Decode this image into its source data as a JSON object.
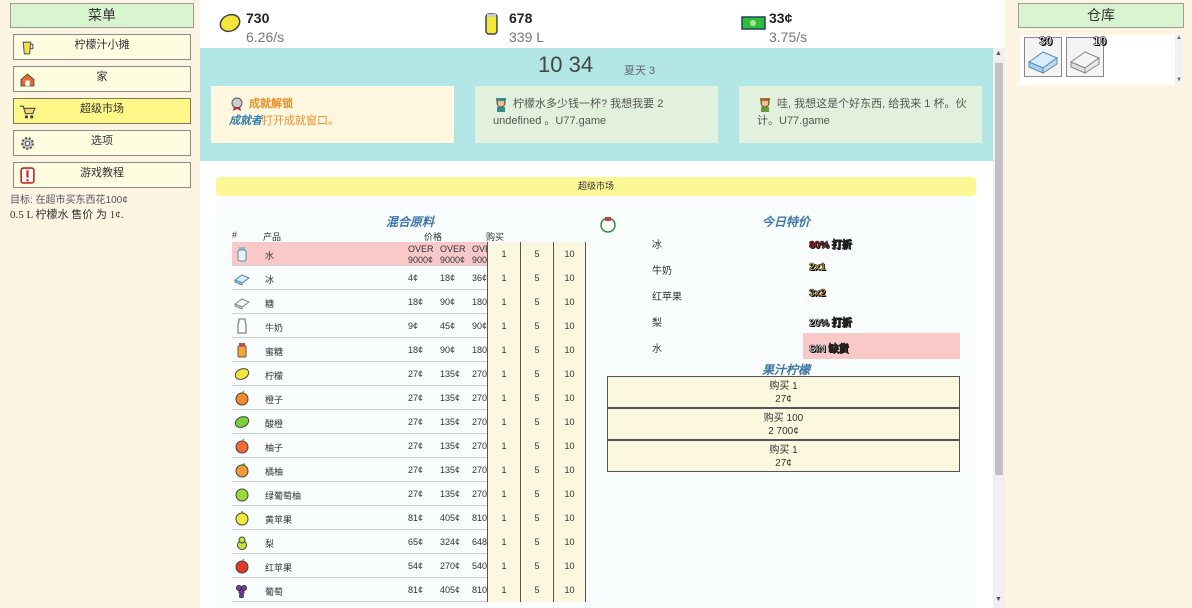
{
  "menu": {
    "title": "菜单",
    "items": [
      {
        "label": "柠檬汁小摊",
        "icon": "lemonade-pitcher-icon"
      },
      {
        "label": "家",
        "icon": "house-icon"
      },
      {
        "label": "超级市场",
        "icon": "shopping-cart-icon"
      },
      {
        "label": "选项",
        "icon": "gear-icon"
      },
      {
        "label": "游戏教程",
        "icon": "exclamation-icon"
      }
    ],
    "goal_label": "目标:",
    "goal_text": "在超市买东西花100¢",
    "goal_line2": "0.5 L 柠檬水 售价 为 1¢."
  },
  "resources": {
    "lemons": {
      "value": "730",
      "rate": "6.26/s",
      "icon": "lemon-icon"
    },
    "lemonade": {
      "value": "678",
      "rate": "339 L",
      "icon": "lemonade-jar-icon"
    },
    "money": {
      "value": "33¢",
      "rate": "3.75/s",
      "icon": "cash-icon"
    }
  },
  "time": {
    "clock": "10 34",
    "season": "夏天 3"
  },
  "messages": {
    "achievement_title": "成就解锁",
    "achievement_name": "成就者",
    "achievement_desc": "打开成就窗口。",
    "customer1": "柠檬水多少钱一杯? 我想我要 2 undefined 。U77.game",
    "customer2": "哇, 我想这是个好东西, 给我来 1 杯。伙计。U77.game"
  },
  "market": {
    "panel_title": "超级市场",
    "table_title": "混合原料",
    "headers": {
      "num": "#",
      "product": "产品",
      "price": "价格",
      "buy": "购买"
    },
    "qty_labels": [
      "1",
      "5",
      "10"
    ],
    "products": [
      {
        "name": "水",
        "icon": "water-bottle-icon",
        "p1": "OVER 9000¢",
        "p5": "OVER 9000¢",
        "p10": "OVER 9000¢",
        "out_of_stock": true
      },
      {
        "name": "冰",
        "icon": "ice-icon",
        "p1": "4¢",
        "p5": "18¢",
        "p10": "36¢"
      },
      {
        "name": "糖",
        "icon": "sugar-icon",
        "p1": "18¢",
        "p5": "90¢",
        "p10": "180¢"
      },
      {
        "name": "牛奶",
        "icon": "milk-icon",
        "p1": "9¢",
        "p5": "45¢",
        "p10": "90¢"
      },
      {
        "name": "蜜糖",
        "icon": "honey-icon",
        "p1": "18¢",
        "p5": "90¢",
        "p10": "180¢"
      },
      {
        "name": "柠檬",
        "icon": "lemon-icon",
        "p1": "27¢",
        "p5": "135¢",
        "p10": "270¢"
      },
      {
        "name": "橙子",
        "icon": "orange-icon",
        "p1": "27¢",
        "p5": "135¢",
        "p10": "270¢"
      },
      {
        "name": "酸橙",
        "icon": "lime-icon",
        "p1": "27¢",
        "p5": "135¢",
        "p10": "270¢"
      },
      {
        "name": "柚子",
        "icon": "grapefruit-icon",
        "p1": "27¢",
        "p5": "135¢",
        "p10": "270¢"
      },
      {
        "name": "橘柚",
        "icon": "tangelo-icon",
        "p1": "27¢",
        "p5": "135¢",
        "p10": "270¢"
      },
      {
        "name": "绿葡萄柚",
        "icon": "green-grapefruit-icon",
        "p1": "27¢",
        "p5": "135¢",
        "p10": "270¢"
      },
      {
        "name": "黄苹果",
        "icon": "yellow-apple-icon",
        "p1": "81¢",
        "p5": "405¢",
        "p10": "810¢"
      },
      {
        "name": "梨",
        "icon": "pear-icon",
        "p1": "65¢",
        "p5": "324¢",
        "p10": "648¢"
      },
      {
        "name": "红苹果",
        "icon": "red-apple-icon",
        "p1": "54¢",
        "p5": "270¢",
        "p10": "540¢"
      },
      {
        "name": "葡萄",
        "icon": "grapes-icon",
        "p1": "81¢",
        "p5": "405¢",
        "p10": "810¢"
      }
    ],
    "specials_title": "今日特价",
    "specials": [
      {
        "item": "冰",
        "deal": "80% 打折",
        "color": "#e01818"
      },
      {
        "item": "牛奶",
        "deal": "2x1",
        "color": "#ffd83c"
      },
      {
        "item": "红苹果",
        "deal": "3x2",
        "color": "#ffb43a"
      },
      {
        "item": "梨",
        "deal": "20% 打折",
        "color": "#ffffff"
      },
      {
        "item": "水",
        "deal": "SIN 缺货",
        "color": "#ffffff",
        "highlight": true
      }
    ],
    "juice_title": "果汁柠檬",
    "juice_options": [
      {
        "label": "购买 1",
        "price": "27¢"
      },
      {
        "label": "购买 100",
        "price": "2 700¢"
      },
      {
        "label": "购买 1",
        "price": "27¢"
      }
    ]
  },
  "warehouse": {
    "title": "仓库",
    "items": [
      {
        "count": "30",
        "icon": "ice-block-icon"
      },
      {
        "count": "10",
        "icon": "sugar-block-icon"
      }
    ]
  }
}
